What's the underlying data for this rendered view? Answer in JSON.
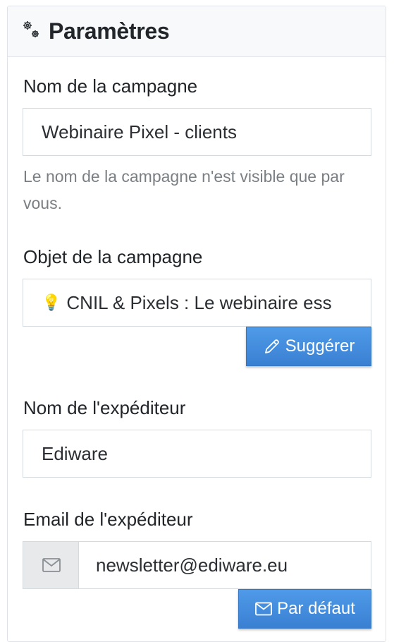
{
  "header": {
    "title": "Paramètres",
    "icon": "gears-icon"
  },
  "campaign_name": {
    "label": "Nom de la campagne",
    "value": "Webinaire Pixel - clients",
    "help": "Le nom de la campagne n'est visible que par vous."
  },
  "campaign_subject": {
    "label": "Objet de la campagne",
    "emoji": "💡",
    "value": "CNIL & Pixels : Le webinaire ess",
    "suggest_label": "Suggérer",
    "suggest_icon": "pencil-icon"
  },
  "sender_name": {
    "label": "Nom de l'expéditeur",
    "value": "Ediware"
  },
  "sender_email": {
    "label": "Email de l'expéditeur",
    "addon_icon": "envelope-icon",
    "value": "newsletter@ediware.eu",
    "default_label": "Par défaut",
    "default_icon": "envelope-icon"
  },
  "colors": {
    "accent": "#3d85d6",
    "muted_text": "#7a7f84",
    "border": "#d5dadf"
  }
}
